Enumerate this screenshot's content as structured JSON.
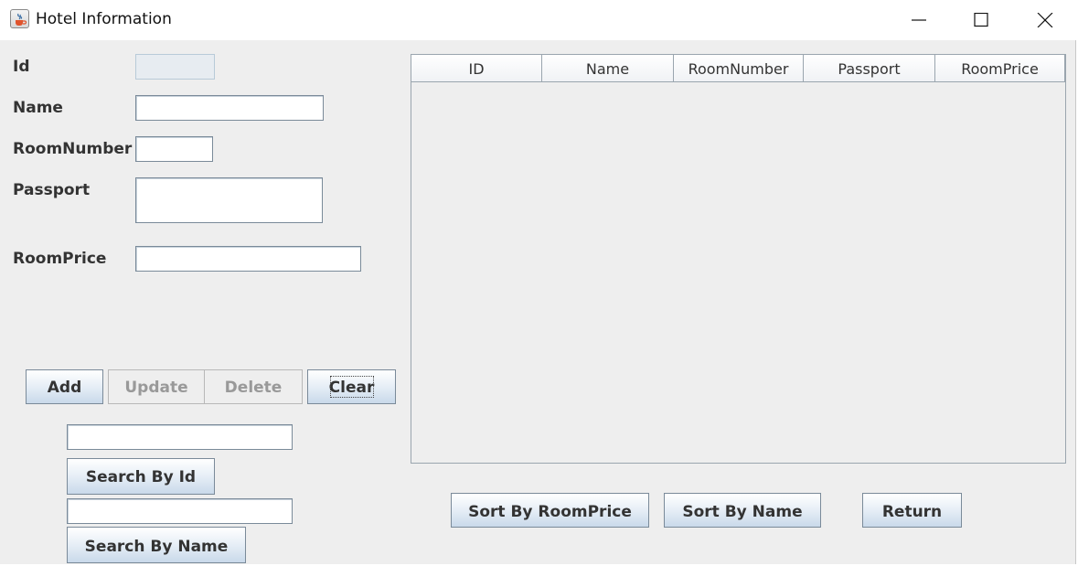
{
  "window": {
    "title": "Hotel Information",
    "controls": [
      "minimize",
      "maximize",
      "close"
    ]
  },
  "form": {
    "id_label": "Id",
    "id_value": "",
    "name_label": "Name",
    "name_value": "",
    "room_number_label": "RoomNumber",
    "room_number_value": "",
    "passport_label": "Passport",
    "passport_value": "",
    "room_price_label": "RoomPrice",
    "room_price_value": ""
  },
  "actions": {
    "add": "Add",
    "update": "Update",
    "delete": "Delete",
    "clear": "Clear"
  },
  "search": {
    "id_value": "",
    "by_id": "Search By Id",
    "name_value": "",
    "by_name": "Search By Name"
  },
  "table": {
    "columns": [
      "ID",
      "Name",
      "RoomNumber",
      "Passport",
      "RoomPrice"
    ],
    "rows": []
  },
  "bottom": {
    "sort_price": "Sort By RoomPrice",
    "sort_name": "Sort By Name",
    "return": "Return"
  },
  "colors": {
    "panel": "#eeeeee",
    "button_gradient_bottom": "#c9d9ea",
    "disabled_text": "#999999"
  }
}
